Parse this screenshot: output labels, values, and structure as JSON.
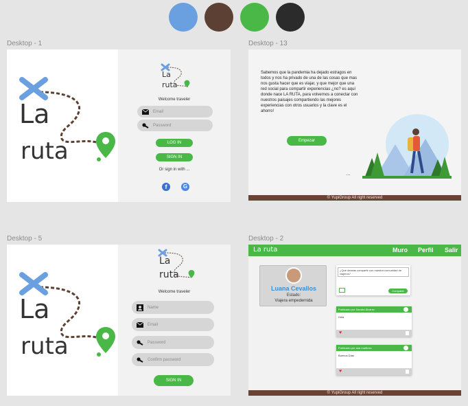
{
  "palette": [
    "#6a9fe0",
    "#5c4033",
    "#4ab847",
    "#2b2b2b"
  ],
  "frames": {
    "desktop1": {
      "label": "Desktop - 1",
      "logo_line1": "La",
      "logo_line2": "ruta",
      "welcome": "Welcome traveler",
      "email_placeholder": "Email",
      "password_placeholder": "Password",
      "login_label": "LOG IN",
      "signin_label": "SIGN IN",
      "or_text": "Or sign in with ...",
      "facebook_glyph": "f",
      "google_glyph": "G"
    },
    "desktop13": {
      "label": "Desktop - 13",
      "paragraph": "Sabemos que la pandemia ha dejado estragos en todos y nos ha privado de una de las cosas que mas nos gusta hacer que es viajar, y que mejor que una red social para compartir experiencias ¿no? es aquí donde nace LA RUTA, para volvernos a conectar con nuestros paisajes compartiendo las mejores experiencias con otros usuarios y la clave es el ahorro!",
      "button": "Empezar",
      "dots": "...",
      "footer": "© YupiGroup All right reserved"
    },
    "desktop5": {
      "label": "Desktop - 5",
      "logo_line1": "La",
      "logo_line2": "ruta",
      "welcome": "Welcome traveler",
      "name_placeholder": "Name",
      "email_placeholder": "Email",
      "password_placeholder": "Password",
      "confirm_placeholder": "Confirm password",
      "signin_label": "SIGN IN"
    },
    "desktop2": {
      "label": "Desktop - 2",
      "brand": "La ruta",
      "nav": [
        "Muro",
        "Perfil",
        "Salir"
      ],
      "profile_name": "Luana Cevallos",
      "estado_label": "Estado:",
      "estado_value": "Viajera empedernida",
      "post_prompt": "¿Qué deseas compartir con nuestra comunidad de viajeros?",
      "share_button": "Comparte",
      "posts": [
        {
          "header": "Publicado por Sandra Álvarez",
          "body": "Hola"
        },
        {
          "header": "Publicado por ana martinez",
          "body": "Buenos Días"
        }
      ],
      "footer": "© YupiGroup All right reserved"
    }
  }
}
